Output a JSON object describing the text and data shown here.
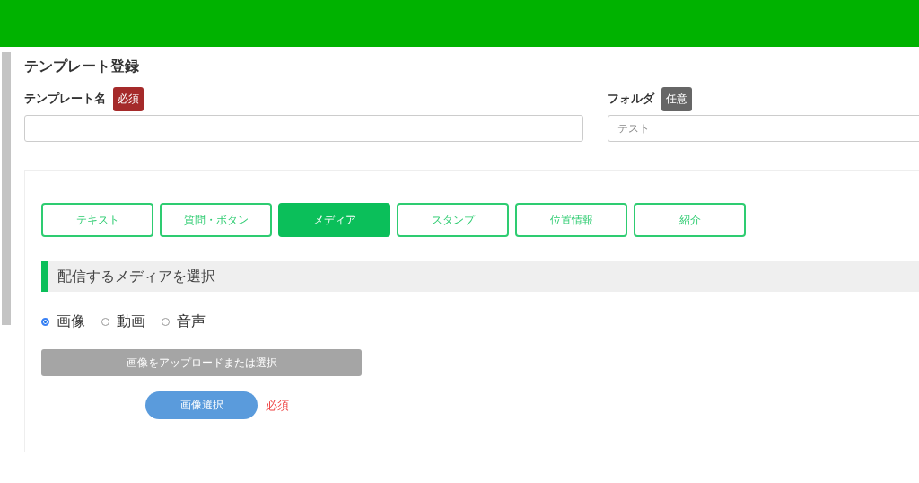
{
  "page_title": "テンプレート登録",
  "fields": [
    {
      "label": "テンプレート名",
      "badge": "必須",
      "kind": "required"
    },
    {
      "label": "フォルダ",
      "badge": "任意",
      "kind": "optional",
      "placeholder": "テスト"
    }
  ],
  "tabs": [
    {
      "label": "テキスト",
      "selected": false
    },
    {
      "label": "質問・ボタン",
      "selected": false
    },
    {
      "label": "メディア",
      "selected": true
    },
    {
      "label": "スタンプ",
      "selected": false
    },
    {
      "label": "位置情報",
      "selected": false
    },
    {
      "label": "紹介",
      "selected": false
    }
  ],
  "section_heading": "配信するメディアを選択",
  "media_options": [
    {
      "label": "画像",
      "selected": true
    },
    {
      "label": "動画",
      "selected": false
    },
    {
      "label": "音声",
      "selected": false
    }
  ],
  "upload_bar": "画像をアップロードまたは選択",
  "select_button": "画像選択",
  "required_note": "必須"
}
